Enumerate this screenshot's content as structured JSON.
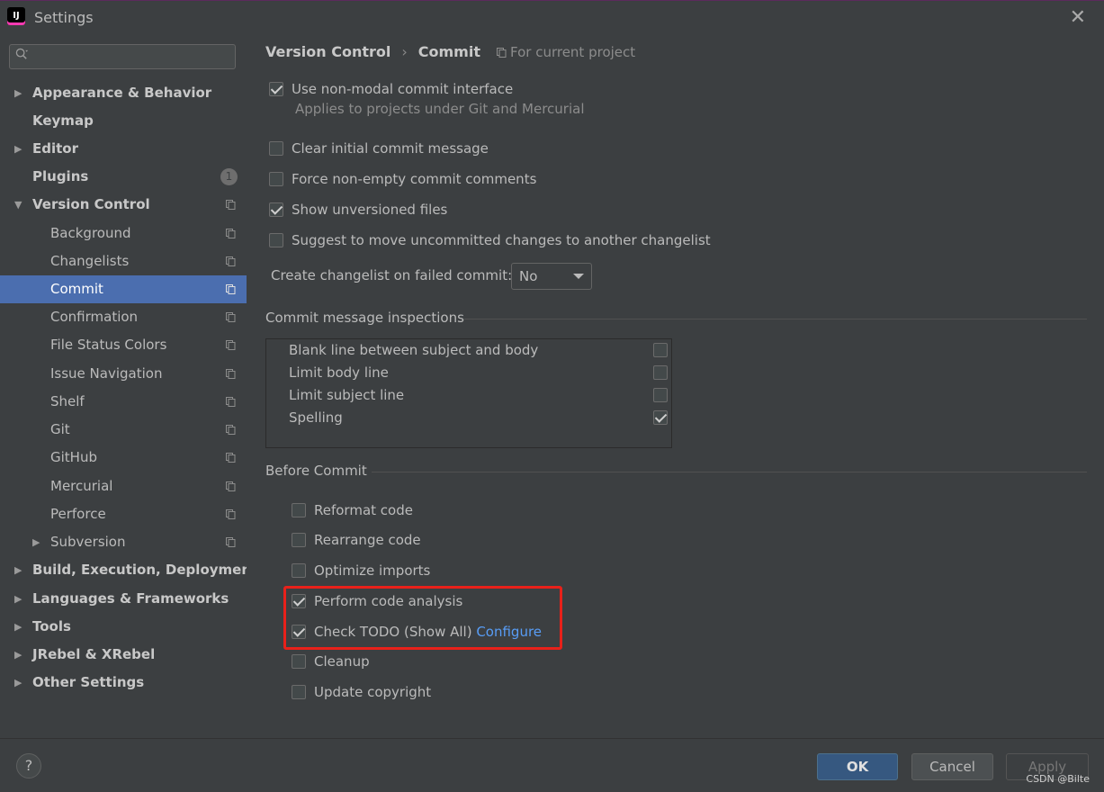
{
  "window": {
    "title": "Settings",
    "app_icon_text": "IJ"
  },
  "sidebar": {
    "search_placeholder": "",
    "items": [
      {
        "label": "Appearance & Behavior",
        "arrow": "▶",
        "bold": true,
        "indent": 0
      },
      {
        "label": "Keymap",
        "arrow": "",
        "bold": true,
        "indent": 0
      },
      {
        "label": "Editor",
        "arrow": "▶",
        "bold": true,
        "indent": 0
      },
      {
        "label": "Plugins",
        "arrow": "",
        "bold": true,
        "indent": 0,
        "badge": "1"
      },
      {
        "label": "Version Control",
        "arrow": "▼",
        "bold": true,
        "indent": 0,
        "project": true
      },
      {
        "label": "Background",
        "arrow": "",
        "bold": false,
        "indent": 1,
        "project": true
      },
      {
        "label": "Changelists",
        "arrow": "",
        "bold": false,
        "indent": 1,
        "project": true
      },
      {
        "label": "Commit",
        "arrow": "",
        "bold": false,
        "indent": 1,
        "project": true,
        "selected": true
      },
      {
        "label": "Confirmation",
        "arrow": "",
        "bold": false,
        "indent": 1,
        "project": true
      },
      {
        "label": "File Status Colors",
        "arrow": "",
        "bold": false,
        "indent": 1,
        "project": true
      },
      {
        "label": "Issue Navigation",
        "arrow": "",
        "bold": false,
        "indent": 1,
        "project": true
      },
      {
        "label": "Shelf",
        "arrow": "",
        "bold": false,
        "indent": 1,
        "project": true
      },
      {
        "label": "Git",
        "arrow": "",
        "bold": false,
        "indent": 1,
        "project": true
      },
      {
        "label": "GitHub",
        "arrow": "",
        "bold": false,
        "indent": 1,
        "project": true
      },
      {
        "label": "Mercurial",
        "arrow": "",
        "bold": false,
        "indent": 1,
        "project": true
      },
      {
        "label": "Perforce",
        "arrow": "",
        "bold": false,
        "indent": 1,
        "project": true
      },
      {
        "label": "Subversion",
        "arrow": "▶",
        "bold": false,
        "indent": 1,
        "project": true
      },
      {
        "label": "Build, Execution, Deployment",
        "arrow": "▶",
        "bold": true,
        "indent": 0
      },
      {
        "label": "Languages & Frameworks",
        "arrow": "▶",
        "bold": true,
        "indent": 0
      },
      {
        "label": "Tools",
        "arrow": "▶",
        "bold": true,
        "indent": 0
      },
      {
        "label": "JRebel & XRebel",
        "arrow": "▶",
        "bold": true,
        "indent": 0
      },
      {
        "label": "Other Settings",
        "arrow": "▶",
        "bold": true,
        "indent": 0
      }
    ]
  },
  "breadcrumb": {
    "parent": "Version Control",
    "separator": "›",
    "current": "Commit"
  },
  "scope_label": "For current project",
  "options": {
    "non_modal": {
      "label": "Use non-modal commit interface",
      "checked": true
    },
    "non_modal_hint": "Applies to projects under Git and Mercurial",
    "clear_initial": {
      "label": "Clear initial commit message",
      "checked": false
    },
    "force_nonempty": {
      "label": "Force non-empty commit comments",
      "checked": false
    },
    "show_unversioned": {
      "label": "Show unversioned files",
      "checked": true
    },
    "suggest_move": {
      "label": "Suggest to move uncommitted changes to another changelist",
      "checked": false
    }
  },
  "changelist_failed": {
    "label": "Create changelist on failed commit:",
    "value": "No"
  },
  "inspections": {
    "title": "Commit message inspections",
    "items": [
      {
        "label": "Blank line between subject and body",
        "checked": false
      },
      {
        "label": "Limit body line",
        "checked": false
      },
      {
        "label": "Limit subject line",
        "checked": false
      },
      {
        "label": "Spelling",
        "checked": true
      }
    ]
  },
  "before_commit": {
    "title": "Before Commit",
    "items": [
      {
        "label": "Reformat code",
        "checked": false
      },
      {
        "label": "Rearrange code",
        "checked": false
      },
      {
        "label": "Optimize imports",
        "checked": false
      },
      {
        "label": "Perform code analysis",
        "checked": true
      },
      {
        "label": "Check TODO (Show All)",
        "checked": true,
        "link": "Configure"
      },
      {
        "label": "Cleanup",
        "checked": false
      },
      {
        "label": "Update copyright",
        "checked": false
      }
    ]
  },
  "footer": {
    "help": "?",
    "ok": "OK",
    "cancel": "Cancel",
    "apply": "Apply"
  },
  "watermark": "CSDN @Bilte",
  "colors": {
    "accent": "#4b6eaf",
    "link": "#589df6",
    "highlight": "#e8211a",
    "ok_button": "#365880"
  }
}
